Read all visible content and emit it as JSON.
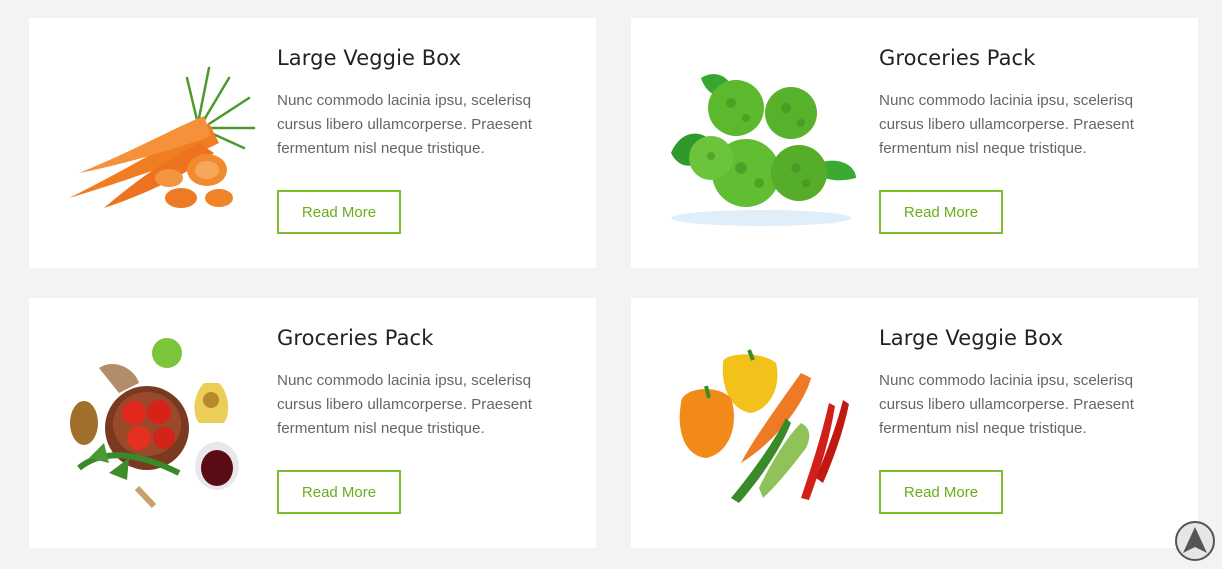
{
  "cards": [
    {
      "title": "Large Veggie Box",
      "description": "Nunc commodo lacinia ipsu, scelerisq cursus libero ullamcorperse. Praesent fermentum nisl neque tristique.",
      "button_label": "Read More",
      "image": "carrots-image"
    },
    {
      "title": "Groceries Pack",
      "description": "Nunc commodo lacinia ipsu, scelerisq cursus libero ullamcorperse. Praesent fermentum nisl neque tristique.",
      "button_label": "Read More",
      "image": "bergamot-image"
    },
    {
      "title": "Groceries Pack",
      "description": "Nunc commodo lacinia ipsu, scelerisq cursus libero ullamcorperse. Praesent fermentum nisl neque tristique.",
      "button_label": "Read More",
      "image": "tomato-bowl-image"
    },
    {
      "title": "Large Veggie Box",
      "description": "Nunc commodo lacinia ipsu, scelerisq cursus libero ullamcorperse. Praesent fermentum nisl neque tristique.",
      "button_label": "Read More",
      "image": "peppers-image"
    }
  ],
  "scroll_to_top": {
    "icon": "arrow-up-icon"
  },
  "colors": {
    "page_background": "#f4f3f3",
    "card_background": "#ffffff",
    "accent": "#7cbf2a",
    "title_text": "#222222",
    "body_text": "#666666"
  }
}
